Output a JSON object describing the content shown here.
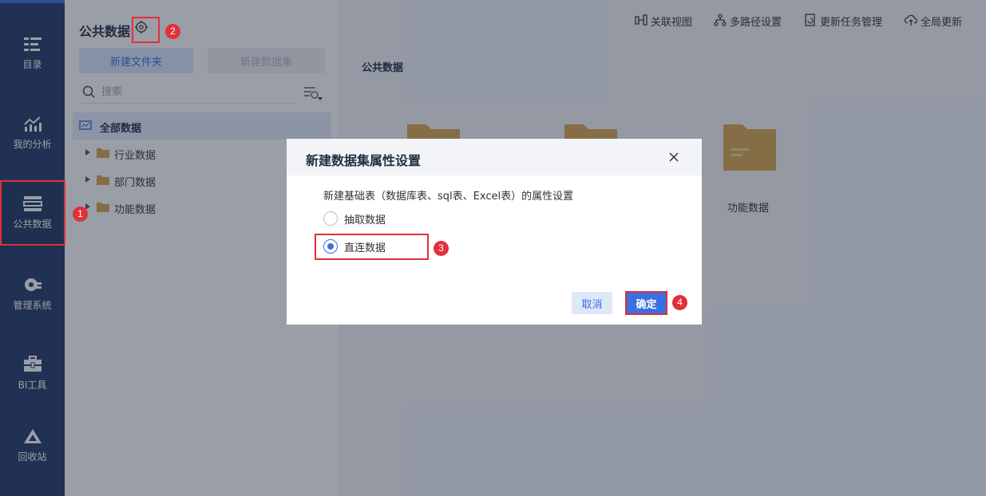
{
  "nav": {
    "items": [
      {
        "label": "目录",
        "icon": "catalog-icon"
      },
      {
        "label": "我的分析",
        "icon": "analysis-icon"
      },
      {
        "label": "公共数据",
        "icon": "public-data-icon"
      },
      {
        "label": "管理系统",
        "icon": "management-gear-icon"
      },
      {
        "label": "BI工具",
        "icon": "toolbox-icon"
      },
      {
        "label": "回收站",
        "icon": "recycle-bin-icon"
      }
    ],
    "active": "公共数据"
  },
  "tree": {
    "title": "公共数据",
    "new_folder_label": "新建文件夹",
    "new_dataset_label": "新建数据集",
    "search_placeholder": "搜索",
    "root_label": "全部数据",
    "nodes": [
      {
        "label": "行业数据"
      },
      {
        "label": "部门数据"
      },
      {
        "label": "功能数据"
      }
    ]
  },
  "toolbar": {
    "related_view": "关联视图",
    "multipath": "多路径设置",
    "update_tasks": "更新任务管理",
    "global_update": "全局更新"
  },
  "main": {
    "title": "公共数据",
    "folders": [
      {
        "label": "功能数据"
      }
    ]
  },
  "dialog": {
    "title": "新建数据集属性设置",
    "description": "新建基础表（数据库表、sql表、Excel表）的属性设置",
    "options": [
      {
        "label": "抽取数据",
        "checked": false
      },
      {
        "label": "直连数据",
        "checked": true
      }
    ],
    "cancel_label": "取消",
    "ok_label": "确定"
  },
  "steps": [
    "1",
    "2",
    "3",
    "4"
  ],
  "colors": {
    "nav_bg": "#243a66",
    "accent": "#3a6fe0",
    "highlight": "#e0303a",
    "folder": "#d9a84e"
  }
}
